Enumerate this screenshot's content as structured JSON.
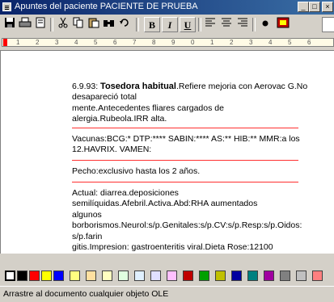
{
  "window": {
    "title": "Apuntes del paciente PACIENTE DE PRUEBA",
    "buttons": {
      "minimize": "_",
      "maximize": "□",
      "close": "×"
    }
  },
  "toolbar": {
    "bold_label": "B",
    "italic_label": "I",
    "underline_label": "U",
    "icons": [
      "save-icon",
      "print-icon",
      "print-preview-icon",
      "cut-icon",
      "copy-icon",
      "paste-icon",
      "find-icon",
      "undo-icon",
      "align-left-icon",
      "align-center-icon",
      "align-right-icon",
      "bullet-icon",
      "insert-object-icon"
    ]
  },
  "ruler": {
    "marks": [
      "1",
      "2",
      "3",
      "4",
      "5",
      "6",
      "7",
      "8",
      "9",
      "0",
      "1",
      "2",
      "3",
      "4",
      "5",
      "6"
    ]
  },
  "document": {
    "entry_date": "6.9.93:",
    "entry_heading": "Tosedora habitual",
    "entry_text": ".Refiere mejoria con Aerovac G.No desapareció total\nmente.Antecedentes fliares cargados de\nalergia.Rubeola.IRR alta.",
    "vaccines": "Vacunas:BCG:*  DTP:**** SABIN:**** AS:** HIB:** MMR:a los\n12.HAVRIX. VAMEN:",
    "feeding": "Pecho:exclusivo hasta los 2 años.",
    "current": "Actual: diarrea.deposiciones\nsemilíquidas.Afebril.Activa.Abd:RHA aumentados\nalgunos\nborborismos.Neurol:s/p.Genitales:s/p.CV:s/p.Resp:s/p.Oidos:\ns/p.farin\ngitis.Impresion: gastroenteritis viral.Dieta Rose:12100"
  },
  "palette": {
    "colors": [
      "#ffffff",
      "#000000",
      "#ff0000",
      "#ffff00",
      "#0000ff",
      "#ffff80",
      "#ffe0a0",
      "#ffffc0",
      "#e0ffe0",
      "#e0f0ff",
      "#e0e0ff",
      "#ffc0ff",
      "#c00000",
      "#00a000",
      "#c0c000",
      "#0000a0",
      "#008080",
      "#a000a0",
      "#808080",
      "#c0c0c0",
      "#ff8080"
    ]
  },
  "status": {
    "text": "Arrastre al documento cualquier objeto OLE"
  }
}
